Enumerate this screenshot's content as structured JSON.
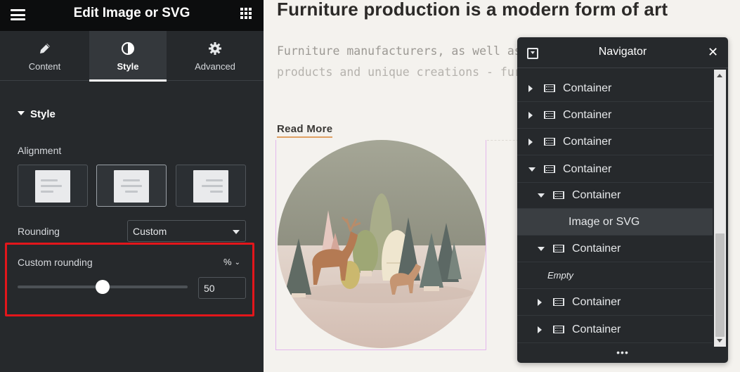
{
  "panel": {
    "title": "Edit Image or SVG",
    "tabs": [
      {
        "label": "Content",
        "icon": "pencil-icon"
      },
      {
        "label": "Style",
        "icon": "contrast-icon",
        "active": true
      },
      {
        "label": "Advanced",
        "icon": "gear-icon"
      }
    ],
    "section_title": "Style",
    "alignment": {
      "label": "Alignment",
      "selected": "center",
      "options": [
        "left",
        "center",
        "right"
      ]
    },
    "rounding": {
      "label": "Rounding",
      "value": "Custom"
    },
    "custom_rounding": {
      "label": "Custom rounding",
      "unit": "%",
      "value": "50",
      "slider_fraction": 0.5
    },
    "highlight_color": "#e3161b"
  },
  "canvas": {
    "heading": "Furniture production is a modern form of art",
    "body_line_1": "Furniture manufacturers, as well as m",
    "body_line_2": "products and unique creations - furn",
    "read_more": "Read More",
    "read_more_underline_color": "#e0a063"
  },
  "navigator": {
    "title": "Navigator",
    "items": [
      {
        "label": "Container",
        "toggle": "collapsed",
        "depth": 0
      },
      {
        "label": "Container",
        "toggle": "collapsed",
        "depth": 0
      },
      {
        "label": "Container",
        "toggle": "collapsed",
        "depth": 0
      },
      {
        "label": "Container",
        "toggle": "expanded",
        "depth": 0
      },
      {
        "label": "Container",
        "toggle": "expanded",
        "depth": 1
      },
      {
        "label": "Image or SVG",
        "toggle": "none",
        "depth": 2,
        "selected": true
      },
      {
        "label": "Container",
        "toggle": "expanded",
        "depth": 1
      },
      {
        "label": "Empty",
        "toggle": "none",
        "depth": 2,
        "empty": true
      },
      {
        "label": "Container",
        "toggle": "collapsed",
        "depth": 1
      },
      {
        "label": "Container",
        "toggle": "collapsed",
        "depth": 1
      }
    ],
    "footer": "•••",
    "scroll": {
      "thumb_start": 0.6,
      "thumb_size": 0.41
    }
  }
}
